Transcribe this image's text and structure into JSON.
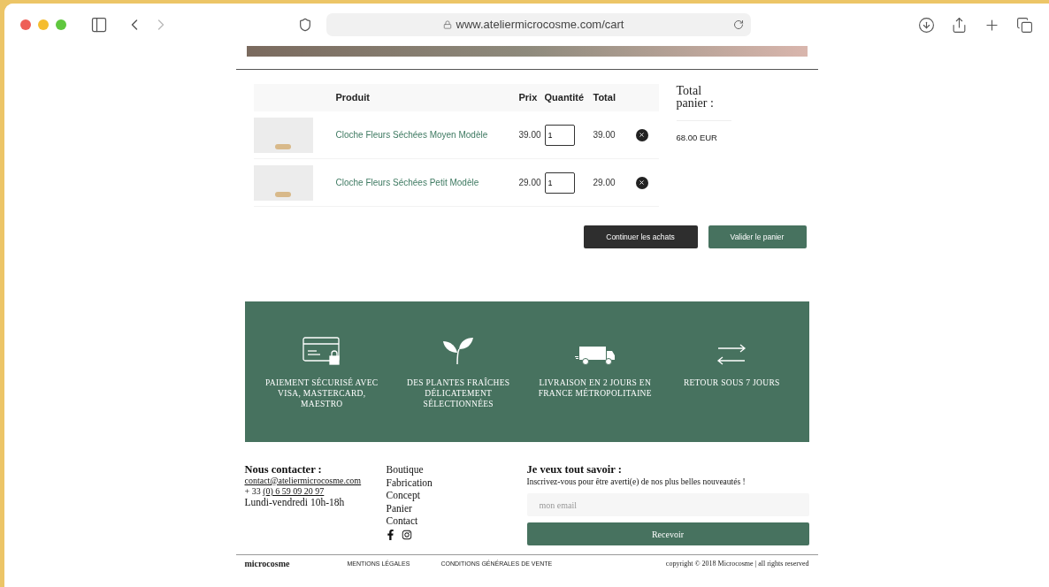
{
  "browser": {
    "url": "www.ateliermicrocosme.com/cart"
  },
  "cart": {
    "columns": [
      "Produit",
      "Prix",
      "Quantité",
      "Total"
    ],
    "items": [
      {
        "name": "Cloche Fleurs Séchées Moyen Modèle",
        "price": "39.00",
        "quantity": "1",
        "total": "39.00"
      },
      {
        "name": "Cloche Fleurs Séchées Petit Modèle",
        "price": "29.00",
        "quantity": "1",
        "total": "29.00"
      }
    ],
    "summary_title": "Total panier :",
    "summary_total": "68.00 EUR",
    "buttons": [
      {
        "label": "Continuer les achats",
        "kind": "secondary"
      },
      {
        "label": "Valider le panier",
        "kind": "primary"
      }
    ]
  },
  "features": [
    {
      "kind": "card",
      "text": "PAIEMENT SÉCURISÉ AVEC VISA, MASTERCARD, MAESTRO"
    },
    {
      "kind": "plant",
      "text": "DES PLANTES FRAÎCHES DÉLICATEMENT SÉLECTIONNÉES"
    },
    {
      "kind": "truck",
      "text": "LIVRAISON EN 2 JOURS EN FRANCE MÉTROPOLITAINE"
    },
    {
      "kind": "return",
      "text": "RETOUR SOUS 7 JOURS"
    }
  ],
  "footer": {
    "contact": {
      "title": "Nous contacter :",
      "email": "contact@ateliermicrocosme.com",
      "phone_prefix": "+ 33",
      "phone": "(0) 6 59 09 20 97",
      "hours": "Lundi-vendredi 10h-18h"
    },
    "links": [
      "Boutique",
      "Fabrication",
      "Concept",
      "Panier",
      "Contact"
    ],
    "newsletter": {
      "title": "Je veux tout savoir :",
      "text": "Inscrivez-vous pour être averti(e) de nos plus belles nouveautés !",
      "placeholder": "mon email",
      "button": "Recevoir"
    },
    "logo": "microcosme",
    "legal_links": [
      "MENTIONS LÉGALES",
      "CONDITIONS GÉNÉRALES DE VENTE"
    ],
    "copyright": "copyright © 2018 Microcosme | all rights reserved"
  }
}
